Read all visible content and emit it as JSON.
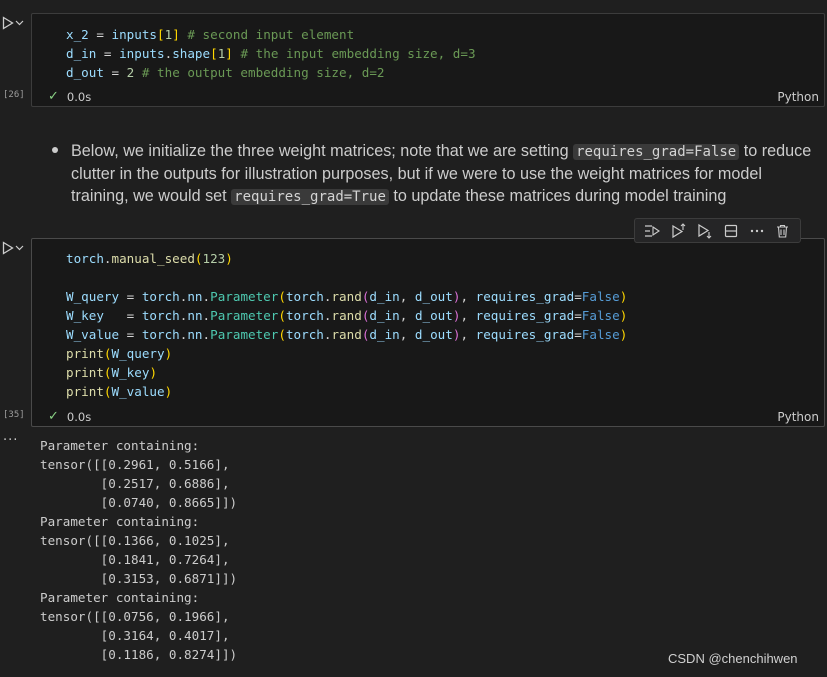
{
  "cell1": {
    "exec_count": "[26]",
    "status_time": "0.0s",
    "language": "Python",
    "lines": [
      [
        {
          "c": "v",
          "t": "x_2"
        },
        {
          "c": "o",
          "t": " = "
        },
        {
          "c": "v",
          "t": "inputs"
        },
        {
          "c": "p1",
          "t": "["
        },
        {
          "c": "n",
          "t": "1"
        },
        {
          "c": "p1",
          "t": "]"
        },
        {
          "c": "o",
          "t": " "
        },
        {
          "c": "c",
          "t": "# second input element"
        }
      ],
      [
        {
          "c": "v",
          "t": "d_in"
        },
        {
          "c": "o",
          "t": " = "
        },
        {
          "c": "v",
          "t": "inputs"
        },
        {
          "c": "o",
          "t": "."
        },
        {
          "c": "v",
          "t": "shape"
        },
        {
          "c": "p1",
          "t": "["
        },
        {
          "c": "n",
          "t": "1"
        },
        {
          "c": "p1",
          "t": "]"
        },
        {
          "c": "o",
          "t": " "
        },
        {
          "c": "c",
          "t": "# the input embedding size, d=3"
        }
      ],
      [
        {
          "c": "v",
          "t": "d_out"
        },
        {
          "c": "o",
          "t": " = "
        },
        {
          "c": "n",
          "t": "2"
        },
        {
          "c": "o",
          "t": " "
        },
        {
          "c": "c",
          "t": "# the output embedding size, d=2"
        }
      ]
    ]
  },
  "markdown": {
    "seg1": "Below, we initialize the three weight matrices; note that we are setting ",
    "code1": "requires_grad=False",
    "seg2": " to reduce clutter in the outputs for illustration purposes, but if we were to use the weight matrices for model training, we would set ",
    "code2": "requires_grad=True",
    "seg3": " to update these matrices during model training"
  },
  "toolbar": {
    "icons": [
      "run-by-line-icon",
      "execute-above-icon",
      "execute-below-icon",
      "split-cell-icon",
      "more-actions-icon",
      "delete-cell-icon"
    ]
  },
  "cell2": {
    "exec_count": "[35]",
    "status_time": "0.0s",
    "language": "Python",
    "lines": [
      [
        {
          "c": "v",
          "t": "torch"
        },
        {
          "c": "o",
          "t": "."
        },
        {
          "c": "f",
          "t": "manual_seed"
        },
        {
          "c": "p1",
          "t": "("
        },
        {
          "c": "n",
          "t": "123"
        },
        {
          "c": "p1",
          "t": ")"
        }
      ],
      [],
      [
        {
          "c": "v",
          "t": "W_query"
        },
        {
          "c": "o",
          "t": " = "
        },
        {
          "c": "v",
          "t": "torch"
        },
        {
          "c": "o",
          "t": "."
        },
        {
          "c": "v",
          "t": "nn"
        },
        {
          "c": "o",
          "t": "."
        },
        {
          "c": "t",
          "t": "Parameter"
        },
        {
          "c": "p1",
          "t": "("
        },
        {
          "c": "v",
          "t": "torch"
        },
        {
          "c": "o",
          "t": "."
        },
        {
          "c": "f",
          "t": "rand"
        },
        {
          "c": "p2",
          "t": "("
        },
        {
          "c": "v",
          "t": "d_in"
        },
        {
          "c": "o",
          "t": ", "
        },
        {
          "c": "v",
          "t": "d_out"
        },
        {
          "c": "p2",
          "t": ")"
        },
        {
          "c": "o",
          "t": ", "
        },
        {
          "c": "v",
          "t": "requires_grad"
        },
        {
          "c": "o",
          "t": "="
        },
        {
          "c": "k",
          "t": "False"
        },
        {
          "c": "p1",
          "t": ")"
        }
      ],
      [
        {
          "c": "v",
          "t": "W_key"
        },
        {
          "c": "o",
          "t": "   = "
        },
        {
          "c": "v",
          "t": "torch"
        },
        {
          "c": "o",
          "t": "."
        },
        {
          "c": "v",
          "t": "nn"
        },
        {
          "c": "o",
          "t": "."
        },
        {
          "c": "t",
          "t": "Parameter"
        },
        {
          "c": "p1",
          "t": "("
        },
        {
          "c": "v",
          "t": "torch"
        },
        {
          "c": "o",
          "t": "."
        },
        {
          "c": "f",
          "t": "rand"
        },
        {
          "c": "p2",
          "t": "("
        },
        {
          "c": "v",
          "t": "d_in"
        },
        {
          "c": "o",
          "t": ", "
        },
        {
          "c": "v",
          "t": "d_out"
        },
        {
          "c": "p2",
          "t": ")"
        },
        {
          "c": "o",
          "t": ", "
        },
        {
          "c": "v",
          "t": "requires_grad"
        },
        {
          "c": "o",
          "t": "="
        },
        {
          "c": "k",
          "t": "False"
        },
        {
          "c": "p1",
          "t": ")"
        }
      ],
      [
        {
          "c": "v",
          "t": "W_value"
        },
        {
          "c": "o",
          "t": " = "
        },
        {
          "c": "v",
          "t": "torch"
        },
        {
          "c": "o",
          "t": "."
        },
        {
          "c": "v",
          "t": "nn"
        },
        {
          "c": "o",
          "t": "."
        },
        {
          "c": "t",
          "t": "Parameter"
        },
        {
          "c": "p1",
          "t": "("
        },
        {
          "c": "v",
          "t": "torch"
        },
        {
          "c": "o",
          "t": "."
        },
        {
          "c": "f",
          "t": "rand"
        },
        {
          "c": "p2",
          "t": "("
        },
        {
          "c": "v",
          "t": "d_in"
        },
        {
          "c": "o",
          "t": ", "
        },
        {
          "c": "v",
          "t": "d_out"
        },
        {
          "c": "p2",
          "t": ")"
        },
        {
          "c": "o",
          "t": ", "
        },
        {
          "c": "v",
          "t": "requires_grad"
        },
        {
          "c": "o",
          "t": "="
        },
        {
          "c": "k",
          "t": "False"
        },
        {
          "c": "p1",
          "t": ")"
        }
      ],
      [
        {
          "c": "f",
          "t": "print"
        },
        {
          "c": "p1",
          "t": "("
        },
        {
          "c": "v",
          "t": "W_query"
        },
        {
          "c": "p1",
          "t": ")"
        }
      ],
      [
        {
          "c": "f",
          "t": "print"
        },
        {
          "c": "p1",
          "t": "("
        },
        {
          "c": "v",
          "t": "W_key"
        },
        {
          "c": "p1",
          "t": ")"
        }
      ],
      [
        {
          "c": "f",
          "t": "print"
        },
        {
          "c": "p1",
          "t": "("
        },
        {
          "c": "v",
          "t": "W_value"
        },
        {
          "c": "p1",
          "t": ")"
        }
      ]
    ]
  },
  "output": {
    "text": "Parameter containing:\ntensor([[0.2961, 0.5166],\n        [0.2517, 0.6886],\n        [0.0740, 0.8665]])\nParameter containing:\ntensor([[0.1366, 0.1025],\n        [0.1841, 0.7264],\n        [0.3153, 0.6871]])\nParameter containing:\ntensor([[0.0756, 0.1966],\n        [0.3164, 0.4017],\n        [0.1186, 0.8274]])"
  },
  "watermark": "CSDN @chenchihwen",
  "colors": {
    "background": "#1f1f1f",
    "cell_background": "#181818",
    "success_check": "#89d185",
    "comment": "#6a9955"
  }
}
